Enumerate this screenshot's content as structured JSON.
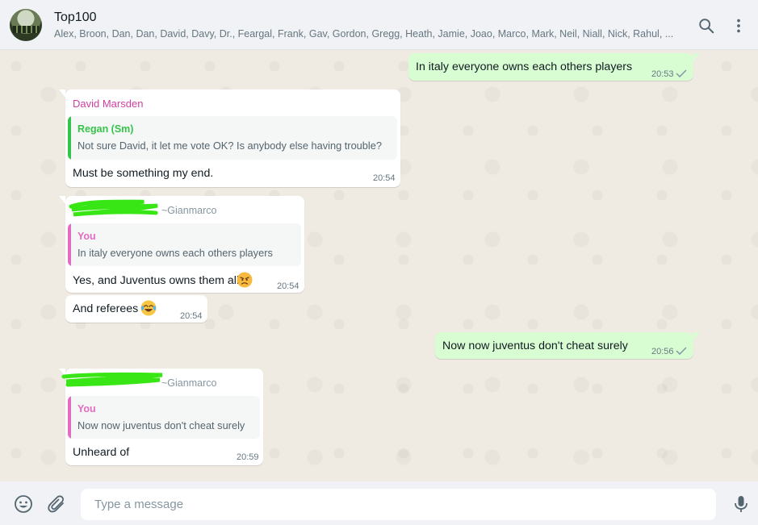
{
  "header": {
    "title": "Top100",
    "subtitle": "Alex, Broon, Dan, Dan, David, Davy, Dr., Feargal, Frank, Gav, Gordon, Gregg, Heath, Jamie, Joao, Marco, Mark, Neil, Niall, Nick, Rahul, ...",
    "search_icon": "search-icon",
    "menu_icon": "menu-icon"
  },
  "messages": [
    {
      "dir": "out",
      "text": "In italy everyone owns each others players",
      "time": "20:53"
    },
    {
      "dir": "in",
      "sender": "David Marsden",
      "quote_name": "Regan (Sm)",
      "quote_text": "Not sure David, it let me vote OK? Is anybody else having trouble?",
      "text": "Must be something my end.",
      "time": "20:54"
    },
    {
      "dir": "in",
      "sender_suffix": "~Gianmarco",
      "quote_name": "You",
      "quote_text": "In italy everyone owns each others players",
      "text": "Yes, and Juventus owns them all",
      "emoji": "angry-face",
      "time": "20:54"
    },
    {
      "dir": "in",
      "text": "And referees",
      "emoji": "tears-of-joy-face",
      "time": "20:54"
    },
    {
      "dir": "out",
      "text": "Now now juventus don't cheat surely",
      "time": "20:56"
    },
    {
      "dir": "in",
      "sender_suffix": "~Gianmarco",
      "quote_name": "You",
      "quote_text": "Now now juventus don't cheat surely",
      "text": "Unheard of",
      "time": "20:59"
    }
  ],
  "composer": {
    "placeholder": "Type a message",
    "value": ""
  },
  "colors": {
    "outgoing_bubble": "#d9fdd3",
    "incoming_bubble": "#ffffff",
    "sender_david": "#d03fa0",
    "quote_regan": "#35c44a",
    "quote_you": "#e26cc2",
    "redaction": "#39e615"
  }
}
